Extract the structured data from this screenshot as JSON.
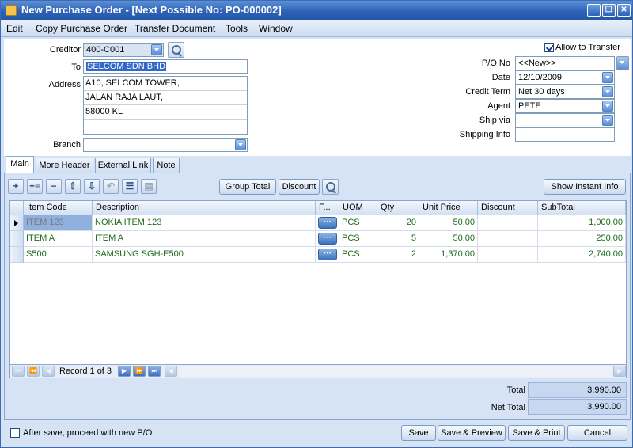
{
  "window": {
    "title": "New Purchase Order - [Next Possible No: PO-000002]",
    "buttons": {
      "minimize": "_",
      "restore": "❐",
      "close": "✕"
    }
  },
  "menu": [
    "Edit",
    "Copy Purchase Order",
    "Transfer Document",
    "Tools",
    "Window"
  ],
  "header_left": {
    "creditor_label": "Creditor",
    "creditor_value": "400-C001",
    "to_label": "To",
    "to_value": "SELCOM SDN BHD",
    "address_label": "Address",
    "address_lines": [
      "A10, SELCOM TOWER,",
      "JALAN RAJA LAUT,",
      "58000 KL",
      ""
    ],
    "branch_label": "Branch",
    "branch_value": ""
  },
  "header_right": {
    "allow_transfer_label": "Allow to Transfer",
    "allow_transfer_checked": true,
    "po_no_label": "P/O  No",
    "po_no_value": "<<New>>",
    "date_label": "Date",
    "date_value": "12/10/2009",
    "credit_term_label": "Credit Term",
    "credit_term_value": "Net 30 days",
    "agent_label": "Agent",
    "agent_value": "PETE",
    "ship_via_label": "Ship via",
    "ship_via_value": "",
    "shipping_info_label": "Shipping Info",
    "shipping_info_value": ""
  },
  "tabs": [
    "Main",
    "More Header",
    "External Link",
    "Note"
  ],
  "active_tab": "Main",
  "toolbar": {
    "group_total": "Group Total",
    "discount": "Discount",
    "show_instant_info": "Show Instant Info"
  },
  "grid": {
    "columns": [
      "Item Code",
      "Description",
      "F...",
      "UOM",
      "Qty",
      "Unit Price",
      "Discount",
      "SubTotal"
    ],
    "ellipsis_label": "···",
    "rows": [
      {
        "item_code": "ITEM 123",
        "description": "NOKIA ITEM 123",
        "uom": "PCS",
        "qty": "20",
        "unit_price": "50.00",
        "discount": "",
        "subtotal": "1,000.00"
      },
      {
        "item_code": "ITEM A",
        "description": "ITEM A",
        "uom": "PCS",
        "qty": "5",
        "unit_price": "50.00",
        "discount": "",
        "subtotal": "250.00"
      },
      {
        "item_code": "S500",
        "description": "SAMSUNG SGH-E500",
        "uom": "PCS",
        "qty": "2",
        "unit_price": "1,370.00",
        "discount": "",
        "subtotal": "2,740.00"
      }
    ]
  },
  "navigator": {
    "record_text": "Record 1 of 3"
  },
  "totals": {
    "total_label": "Total",
    "total_value": "3,990.00",
    "net_total_label": "Net Total",
    "net_total_value": "3,990.00"
  },
  "footer": {
    "after_save_label": "After save, proceed with new P/O",
    "after_save_checked": false,
    "save": "Save",
    "save_preview": "Save & Preview",
    "save_print": "Save & Print",
    "cancel": "Cancel"
  },
  "colors": {
    "titlebar": "#2e63b8",
    "background": "#d5e3f5",
    "grid_text": "#1d6a1d",
    "selection": "#3169c6"
  }
}
